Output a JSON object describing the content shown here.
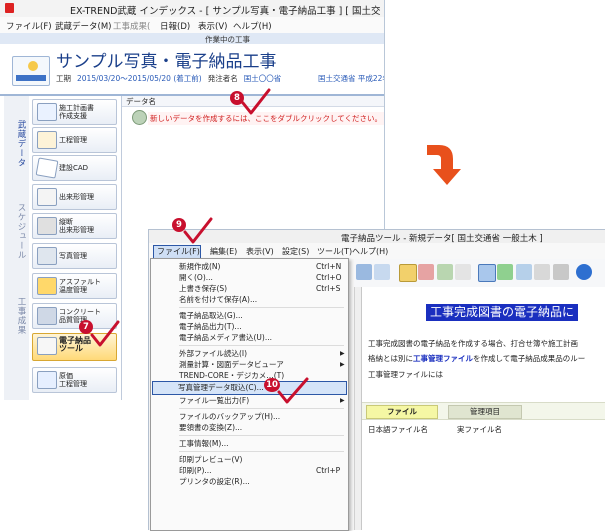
{
  "window1": {
    "title": "EX-TREND武蔵 インデックス - [ サンプル写真・電子納品工事 ] [ 国土交",
    "menu": [
      "ファイル(F)",
      "武蔵データ(M)",
      "工事成果(",
      "日報(D)",
      "表示(V)",
      "ヘルプ(H)"
    ],
    "status": "作業中の工事",
    "project_title": "サンプル写真・電子納品工事",
    "project_info": {
      "period_label": "工期",
      "period": "2015/03/20〜2015/05/20 (着工前)",
      "orderer_label": "発注者名",
      "orderer": "国土〇〇省",
      "right": "国土交通省 平成22年"
    },
    "side_tabs": [
      "武蔵データ",
      "スケジュール",
      "工事成果"
    ],
    "sidebar": [
      "施工計画書\n作成支援",
      "工程管理",
      "建設CAD",
      "出来形管理",
      "縦断\n出来形管理",
      "写真管理",
      "アスファルト\n温度管理",
      "コンクリート\n品質管理",
      "電子納品\nツール",
      "原価\n工程管理"
    ],
    "list_header": "データ名",
    "new_data_hint": "新しいデータを作成するには、ここをダブルクリックしてください。"
  },
  "window2": {
    "title": "電子納品ツール - 新規データ[ 国土交通省 一般土木 ]",
    "menu": [
      "ファイル(F)",
      "編集(E)",
      "表示(V)",
      "設定(S)",
      "ツール(T)",
      "ヘルプ(H)"
    ],
    "doc_heading": "工事完成図書の電子納品に",
    "doc_line1": "工事完成図書の電子納品を作成する場合、打合せ簿や施工計画",
    "doc_line2_a": "格納とは別に",
    "doc_line2_link": "工事管理ファイル",
    "doc_line2_b": "を作成して電子納品成果品のルー",
    "doc_line3": "工事管理ファイルには",
    "tabs": [
      "ファイル",
      "管理項目"
    ],
    "columns": [
      "日本語ファイル名",
      "実ファイル名"
    ]
  },
  "file_menu": [
    {
      "label": "新規作成(N)",
      "shortcut": "Ctrl+N"
    },
    {
      "label": "開く(O)...",
      "shortcut": "Ctrl+O"
    },
    {
      "label": "上書き保存(S)",
      "shortcut": "Ctrl+S"
    },
    {
      "label": "名前を付けて保存(A)...",
      "shortcut": ""
    },
    {
      "sep": true
    },
    {
      "label": "電子納品取込(G)...",
      "shortcut": ""
    },
    {
      "label": "電子納品出力(T)...",
      "shortcut": ""
    },
    {
      "label": "電子納品メディア書込(U)...",
      "shortcut": ""
    },
    {
      "sep": true
    },
    {
      "label": "外部ファイル読込(I)",
      "shortcut": "",
      "arrow": true
    },
    {
      "label": "測量計算・図面データビューア",
      "shortcut": "",
      "arrow": true
    },
    {
      "label": "TREND-CORE・デジカメ…(T)",
      "shortcut": ""
    },
    {
      "label": "写真管理データ取込(C)...",
      "shortcut": "",
      "highlight": true
    },
    {
      "label": "ファイル一覧出力(F)",
      "shortcut": "",
      "arrow": true
    },
    {
      "sep": true
    },
    {
      "label": "ファイルのバックアップ(H)...",
      "shortcut": ""
    },
    {
      "label": "要領書の変換(Z)...",
      "shortcut": ""
    },
    {
      "sep": true
    },
    {
      "label": "工事情報(M)...",
      "shortcut": ""
    },
    {
      "sep": true
    },
    {
      "label": "印刷プレビュー(V)",
      "shortcut": ""
    },
    {
      "label": "印刷(P)...",
      "shortcut": "Ctrl+P"
    },
    {
      "label": "プリンタの設定(R)...",
      "shortcut": ""
    }
  ],
  "badges": [
    "8",
    "9",
    "7",
    "10"
  ],
  "colors": {
    "accent_red": "#c8102e",
    "arrow_orange": "#e8501c",
    "heading_blue": "#1a2fbf"
  }
}
